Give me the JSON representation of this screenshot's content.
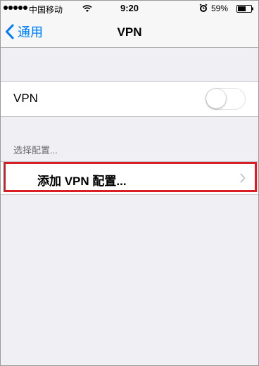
{
  "status_bar": {
    "carrier": "中国移动",
    "time": "9:20",
    "battery_percent": "59%",
    "signal_bars": 5,
    "icons": [
      "signal-dots-icon",
      "wifi-icon",
      "alarm-icon",
      "battery-icon"
    ]
  },
  "nav": {
    "back_label": "通用",
    "title": "VPN"
  },
  "vpn_toggle": {
    "label": "VPN",
    "state": "off"
  },
  "section": {
    "header": "选择配置..."
  },
  "add_config": {
    "label": "添加 VPN 配置..."
  },
  "colors": {
    "accent": "#007aff",
    "background": "#efeff4",
    "highlight": "#d91f26"
  }
}
